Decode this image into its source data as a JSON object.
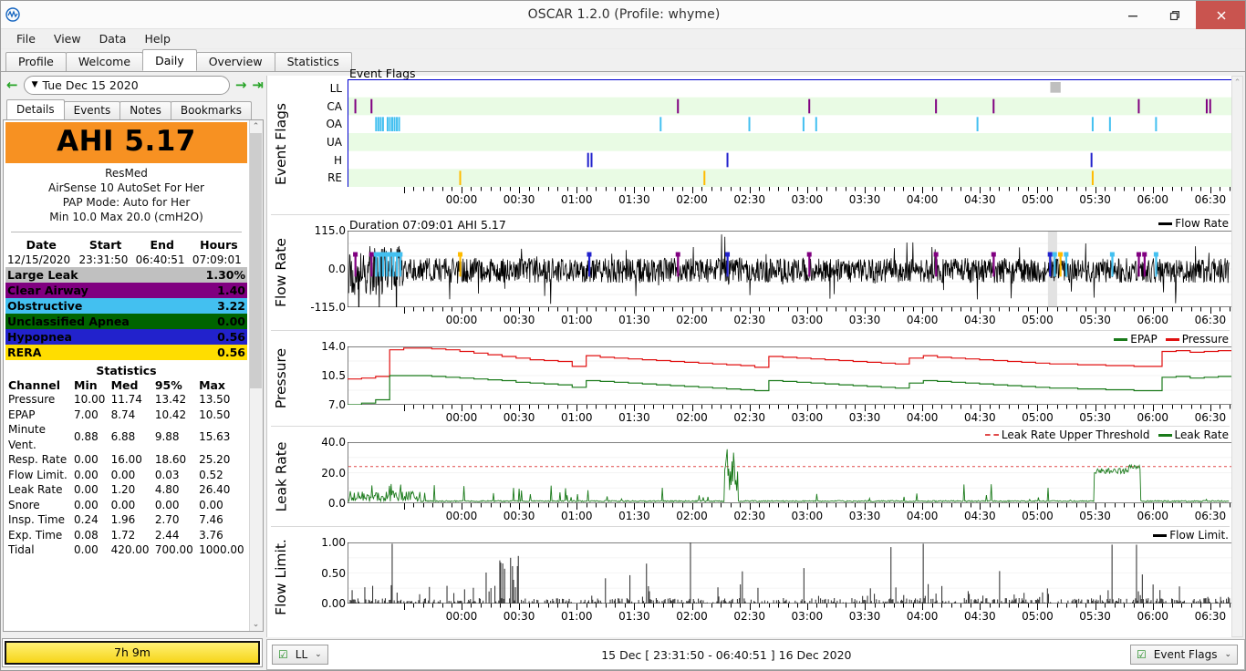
{
  "window": {
    "title": "OSCAR 1.2.0 (Profile: whyme)",
    "app_icon": "oscar-wave-icon",
    "minimize": "–",
    "maximize": "❐",
    "close": "✕"
  },
  "menubar": {
    "items": [
      "File",
      "View",
      "Data",
      "Help"
    ]
  },
  "tabs": {
    "items": [
      "Profile",
      "Welcome",
      "Daily",
      "Overview",
      "Statistics"
    ],
    "active": "Daily"
  },
  "datenav": {
    "prev_icon": "left-arrow-icon",
    "next_icon": "right-arrow-icon",
    "last_icon": "jump-to-end-icon",
    "caret": "▼",
    "date": "Tue Dec 15 2020"
  },
  "subtabs": {
    "items": [
      "Details",
      "Events",
      "Notes",
      "Bookmarks"
    ],
    "active": "Details"
  },
  "details": {
    "ahi_label": "AHI 5.17",
    "machine_brand": "ResMed",
    "machine_model": "AirSense 10 AutoSet For Her",
    "pap_mode": "PAP Mode: Auto for Her",
    "pressure_range": "Min 10.0 Max 20.0 (cmH2O)",
    "session_headers": [
      "Date",
      "Start",
      "End",
      "Hours"
    ],
    "session_values": [
      "12/15/2020",
      "23:31:50",
      "06:40:51",
      "07:09:01"
    ],
    "events": [
      {
        "label": "Large Leak",
        "value": "1.30%",
        "bg": "#c0c0c0",
        "fg": "#000000"
      },
      {
        "label": "Clear Airway",
        "value": "1.40",
        "bg": "#800080",
        "fg": "#ffffff"
      },
      {
        "label": "Obstructive",
        "value": "3.22",
        "bg": "#43c0f0",
        "fg": "#000000"
      },
      {
        "label": "Unclassified Apnea",
        "value": "0.00",
        "bg": "#006400",
        "fg": "#ffffff"
      },
      {
        "label": "Hypopnea",
        "value": "0.56",
        "bg": "#2222cc",
        "fg": "#ffffff"
      },
      {
        "label": "RERA",
        "value": "0.56",
        "bg": "#ffdd00",
        "fg": "#000000"
      }
    ],
    "stats_title": "Statistics",
    "stats_headers": [
      "Channel",
      "Min",
      "Med",
      "95%",
      "Max"
    ],
    "stats_rows": [
      [
        "Pressure",
        "10.00",
        "11.74",
        "13.42",
        "13.50"
      ],
      [
        "EPAP",
        "7.00",
        "8.74",
        "10.42",
        "10.50"
      ],
      [
        "Minute Vent.",
        "0.88",
        "6.88",
        "9.88",
        "15.63"
      ],
      [
        "Resp. Rate",
        "0.00",
        "16.00",
        "18.60",
        "25.20"
      ],
      [
        "Flow Limit.",
        "0.00",
        "0.00",
        "0.03",
        "0.52"
      ],
      [
        "Leak Rate",
        "0.00",
        "1.20",
        "4.80",
        "26.40"
      ],
      [
        "Snore",
        "0.00",
        "0.00",
        "0.00",
        "0.00"
      ],
      [
        "Insp. Time",
        "0.24",
        "1.96",
        "2.70",
        "7.46"
      ],
      [
        "Exp. Time",
        "0.08",
        "1.72",
        "2.44",
        "3.76"
      ],
      [
        "Tidal",
        "0.00",
        "420.00",
        "700.00",
        "1000.00"
      ]
    ],
    "hours_button": "7h 9m"
  },
  "bottombar": {
    "left_combo": {
      "label": "LL",
      "check": "☑",
      "caret": "⌄"
    },
    "status": "15 Dec [ 23:31:50 - 06:40:51 ] 16 Dec 2020",
    "right_combo": {
      "label": "Event Flags",
      "check": "☑",
      "caret": "⌄"
    }
  },
  "chart_data": [
    {
      "type": "scatter",
      "name": "event-flags",
      "title": "Event Flags",
      "ylabel": "Event Flags",
      "xlabel": "",
      "x_ticks": [
        "00:00",
        "00:30",
        "01:00",
        "01:30",
        "02:00",
        "02:30",
        "03:00",
        "03:30",
        "04:00",
        "04:30",
        "05:00",
        "05:30",
        "06:00",
        "06:30"
      ],
      "xlim_hours": [
        -0.53,
        7.15
      ],
      "rows": [
        "LL",
        "CA",
        "OA",
        "UA",
        "H",
        "RE"
      ],
      "row_colors": {
        "LL": "#bfbfbf",
        "CA": "#800080",
        "OA": "#43c0f0",
        "UA": "#006400",
        "H": "#2222cc",
        "RE": "#ffbb00"
      },
      "events": {
        "LL": [
          [
            5.57,
            0.09
          ]
        ],
        "CA": [
          [
            -0.47,
            0.012
          ],
          [
            -0.33,
            0.016
          ],
          [
            2.33,
            0.012
          ],
          [
            3.47,
            0.012
          ],
          [
            4.57,
            0.012
          ],
          [
            5.07,
            0.012
          ],
          [
            6.33,
            0.012
          ],
          [
            6.92,
            0.012
          ],
          [
            6.95,
            0.012
          ]
        ],
        "OA": [
          [
            -0.29,
            0.01
          ],
          [
            -0.27,
            0.01
          ],
          [
            -0.25,
            0.01
          ],
          [
            -0.23,
            0.01
          ],
          [
            -0.19,
            0.01
          ],
          [
            -0.17,
            0.01
          ],
          [
            -0.15,
            0.01
          ],
          [
            -0.13,
            0.01
          ],
          [
            -0.11,
            0.01
          ],
          [
            -0.09,
            0.01
          ],
          [
            2.18,
            0.012
          ],
          [
            2.95,
            0.012
          ],
          [
            3.42,
            0.012
          ],
          [
            3.53,
            0.012
          ],
          [
            4.93,
            0.012
          ],
          [
            5.93,
            0.012
          ],
          [
            6.08,
            0.012
          ],
          [
            6.48,
            0.012
          ]
        ],
        "UA": [],
        "H": [
          [
            1.55,
            0.012
          ],
          [
            1.58,
            0.012
          ],
          [
            2.76,
            0.012
          ],
          [
            5.92,
            0.012
          ]
        ],
        "RE": [
          [
            0.44,
            0.012
          ],
          [
            2.56,
            0.012
          ],
          [
            5.93,
            0.012
          ]
        ]
      }
    },
    {
      "type": "line",
      "name": "flow-rate",
      "title": "Duration 07:09:01 AHI 5.17",
      "ylabel": "Flow Rate",
      "legend": [
        {
          "name": "Flow Rate",
          "color": "#000000"
        }
      ],
      "legend_position": "top-right",
      "ylim": [
        -115.0,
        115.0
      ],
      "y_ticks": [
        "115.0",
        "0.0",
        "-115.0"
      ],
      "x_ticks": [
        "00:00",
        "00:30",
        "01:00",
        "01:30",
        "02:00",
        "02:30",
        "03:00",
        "03:30",
        "04:00",
        "04:30",
        "05:00",
        "05:30",
        "06:00",
        "06:30"
      ]
    },
    {
      "type": "line",
      "name": "pressure",
      "ylabel": "Pressure",
      "legend": [
        {
          "name": "EPAP",
          "color": "#1a7a1a"
        },
        {
          "name": "Pressure",
          "color": "#e01010"
        }
      ],
      "legend_position": "top-right",
      "ylim": [
        7.0,
        14.0
      ],
      "y_ticks": [
        "14.0",
        "10.5",
        "7.0"
      ],
      "x_ticks": [
        "00:00",
        "00:30",
        "01:00",
        "01:30",
        "02:00",
        "02:30",
        "03:00",
        "03:30",
        "04:00",
        "04:30",
        "05:00",
        "05:30",
        "06:00",
        "06:30"
      ],
      "series": [
        {
          "name": "Pressure",
          "color": "#e01010",
          "values": [
            10.1,
            10.2,
            10.4,
            13.6,
            13.8,
            13.8,
            13.7,
            13.6,
            13.4,
            13.2,
            13.0,
            12.8,
            12.6,
            12.4,
            12.3,
            12.2,
            11.6,
            12.9,
            12.7,
            12.6,
            12.5,
            12.4,
            12.3,
            12.2,
            12.1,
            12.0,
            11.9,
            11.8,
            11.7,
            11.5,
            12.8,
            12.7,
            12.6,
            12.5,
            12.4,
            12.3,
            12.2,
            12.1,
            12.0,
            11.9,
            12.6,
            12.9,
            12.7,
            12.6,
            12.5,
            12.4,
            12.3,
            12.2,
            12.1,
            12.0,
            11.9,
            11.9,
            11.8,
            11.8,
            11.7,
            11.7,
            11.6,
            11.6,
            13.4,
            13.5,
            13.3,
            13.4,
            13.5,
            13.5
          ]
        },
        {
          "name": "EPAP",
          "color": "#1a7a1a",
          "values": [
            7.0,
            7.2,
            7.6,
            10.5,
            10.5,
            10.5,
            10.4,
            10.3,
            10.2,
            10.1,
            10.0,
            9.9,
            9.7,
            9.6,
            9.5,
            9.4,
            9.1,
            9.9,
            9.8,
            9.7,
            9.6,
            9.5,
            9.4,
            9.3,
            9.2,
            9.1,
            9.0,
            8.9,
            8.8,
            8.7,
            9.9,
            9.8,
            9.7,
            9.6,
            9.5,
            9.4,
            9.3,
            9.2,
            9.1,
            9.0,
            9.6,
            9.9,
            9.8,
            9.7,
            9.6,
            9.5,
            9.4,
            9.3,
            9.2,
            9.1,
            9.0,
            9.0,
            8.9,
            8.9,
            8.8,
            8.8,
            8.7,
            8.7,
            10.3,
            10.4,
            10.2,
            10.3,
            10.4,
            10.4
          ]
        }
      ]
    },
    {
      "type": "line",
      "name": "leak-rate",
      "ylabel": "Leak Rate",
      "legend": [
        {
          "name": "Leak Rate Upper Threshold",
          "color": "#e04a4a",
          "style": "dashed"
        },
        {
          "name": "Leak Rate",
          "color": "#1a7a1a"
        }
      ],
      "legend_position": "top-right",
      "ylim": [
        0.0,
        40.0
      ],
      "y_ticks": [
        "40.0",
        "20.0",
        "0.0"
      ],
      "threshold": 24.0,
      "x_ticks": [
        "00:00",
        "00:30",
        "01:00",
        "01:30",
        "02:00",
        "02:30",
        "03:00",
        "03:30",
        "04:00",
        "04:30",
        "05:00",
        "05:30",
        "06:00",
        "06:30"
      ],
      "max_value": 36.5
    },
    {
      "type": "line",
      "name": "flow-limit",
      "ylabel": "Flow Limit.",
      "legend": [
        {
          "name": "Flow Limit.",
          "color": "#000000"
        }
      ],
      "legend_position": "top-right",
      "ylim": [
        0.0,
        1.0
      ],
      "y_ticks": [
        "1.00",
        "0.50",
        "0.00"
      ],
      "x_ticks": [
        "00:00",
        "00:30",
        "01:00",
        "01:30",
        "02:00",
        "02:30",
        "03:00",
        "03:30",
        "04:00",
        "04:30",
        "05:00",
        "05:30",
        "06:00",
        "06:30"
      ],
      "max_value": 1.0
    }
  ]
}
